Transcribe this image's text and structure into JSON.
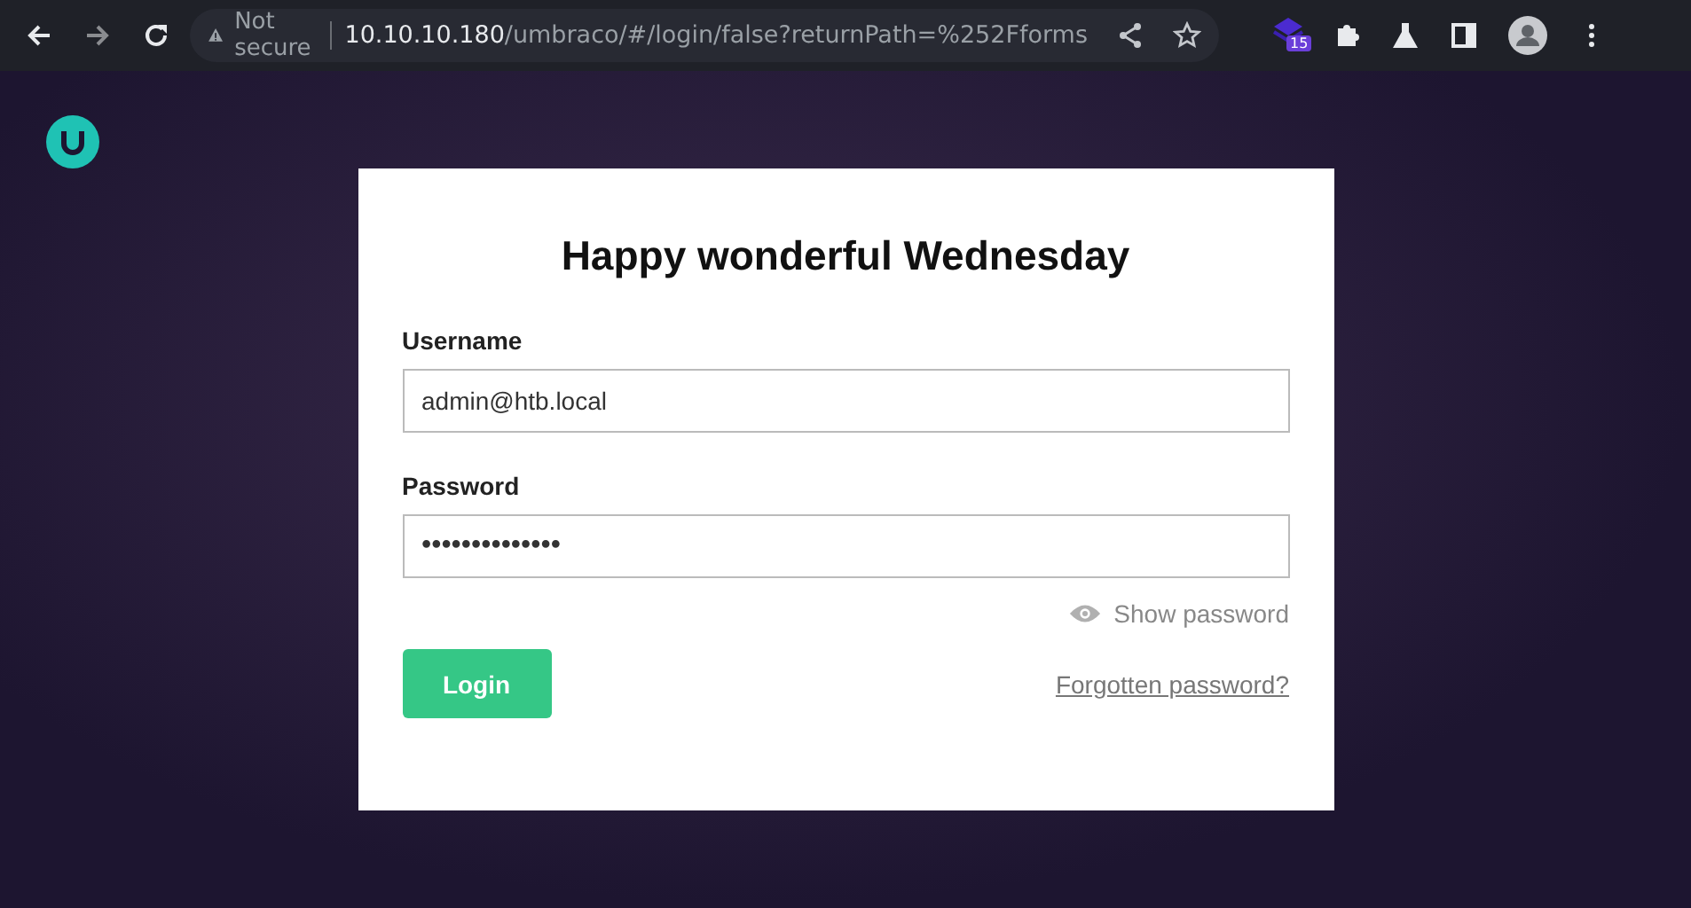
{
  "browser": {
    "security_label": "Not secure",
    "url_host": "10.10.10.180",
    "url_path": "/umbraco/#/login/false?returnPath=%252Fforms",
    "extension_badge": "15"
  },
  "login": {
    "title": "Happy wonderful Wednesday",
    "fields": [
      {
        "label": "Username",
        "value": "admin@htb.local"
      },
      {
        "label": "Password",
        "value": "••••••••••••••"
      }
    ],
    "show_password": "Show password",
    "login_button": "Login",
    "forgot_link": "Forgotten password?"
  }
}
